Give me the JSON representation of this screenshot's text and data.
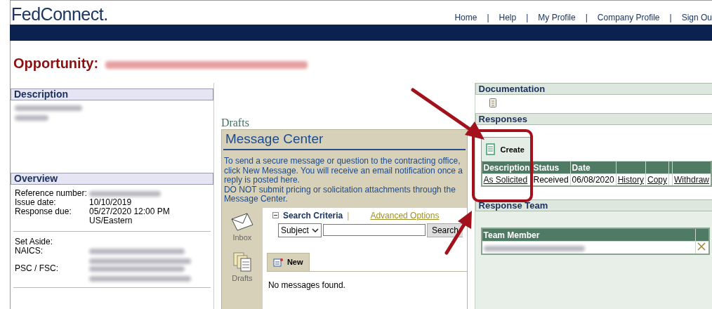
{
  "header": {
    "logo": "FedConnect.",
    "nav": [
      {
        "kind": "link",
        "label": "Home"
      },
      {
        "kind": "separator",
        "label": "|"
      },
      {
        "kind": "link",
        "label": "Help"
      },
      {
        "kind": "separator",
        "label": "|"
      },
      {
        "kind": "link",
        "label": "My Profile"
      },
      {
        "kind": "separator",
        "label": "|"
      },
      {
        "kind": "link",
        "label": "Company Profile"
      },
      {
        "kind": "separator",
        "label": "|"
      },
      {
        "kind": "link",
        "label": "Sign Ou"
      }
    ]
  },
  "page_title": {
    "label": "Opportunity:"
  },
  "description": {
    "heading": "Description"
  },
  "overview": {
    "heading": "Overview",
    "groups": [
      [
        {
          "kind": "blurred",
          "label": "Reference number:"
        },
        {
          "kind": "text",
          "label": "Issue date:",
          "value": "10/10/2019"
        },
        {
          "kind": "text",
          "label": "Response due:",
          "value": "05/27/2020 12:00 PM US/Eastern"
        }
      ],
      [
        {
          "kind": "empty",
          "label": "Set Aside:"
        },
        {
          "kind": "blurred",
          "label": "NAICS:"
        },
        {
          "kind": "blurred",
          "label": "PSC / FSC:"
        }
      ]
    ]
  },
  "message_center": {
    "drafts_label": "Drafts",
    "title": "Message Center",
    "notice": [
      "To send a secure message or question to the contracting office, click New Message. You will receive an email notification once a reply is posted here.",
      "DO NOT submit pricing or solicitation attachments through the Message Center."
    ],
    "sidebar": [
      {
        "kind": "inbox",
        "label": "Inbox"
      },
      {
        "kind": "drafts",
        "label": "Drafts"
      }
    ],
    "search": {
      "title": "Search Criteria",
      "separator": "|",
      "advanced": "Advanced Options",
      "field_select": "Subject",
      "button": "Search"
    },
    "tabs": [
      {
        "label": "New",
        "selected": true
      }
    ],
    "empty_message": "No messages found."
  },
  "documentation": {
    "heading": "Documentation"
  },
  "responses": {
    "heading": "Responses",
    "tabs": [
      {
        "label": "Create",
        "selected": true
      }
    ],
    "columns": [
      "Description",
      "Status",
      "Date",
      "",
      "",
      "",
      ""
    ],
    "rows": [
      [
        {
          "text": "As Solicited",
          "link": true
        },
        {
          "text": "Received",
          "link": false
        },
        {
          "text": "06/08/2020",
          "link": false
        },
        {
          "text": "History",
          "link": true
        },
        {
          "text": "Copy",
          "link": true
        },
        {},
        {
          "text": "Withdraw",
          "link": true
        }
      ]
    ]
  },
  "response_team": {
    "heading": "Response Team",
    "columns": [
      "Team Member",
      ""
    ],
    "rows": [
      {
        "removable": true
      }
    ]
  }
}
